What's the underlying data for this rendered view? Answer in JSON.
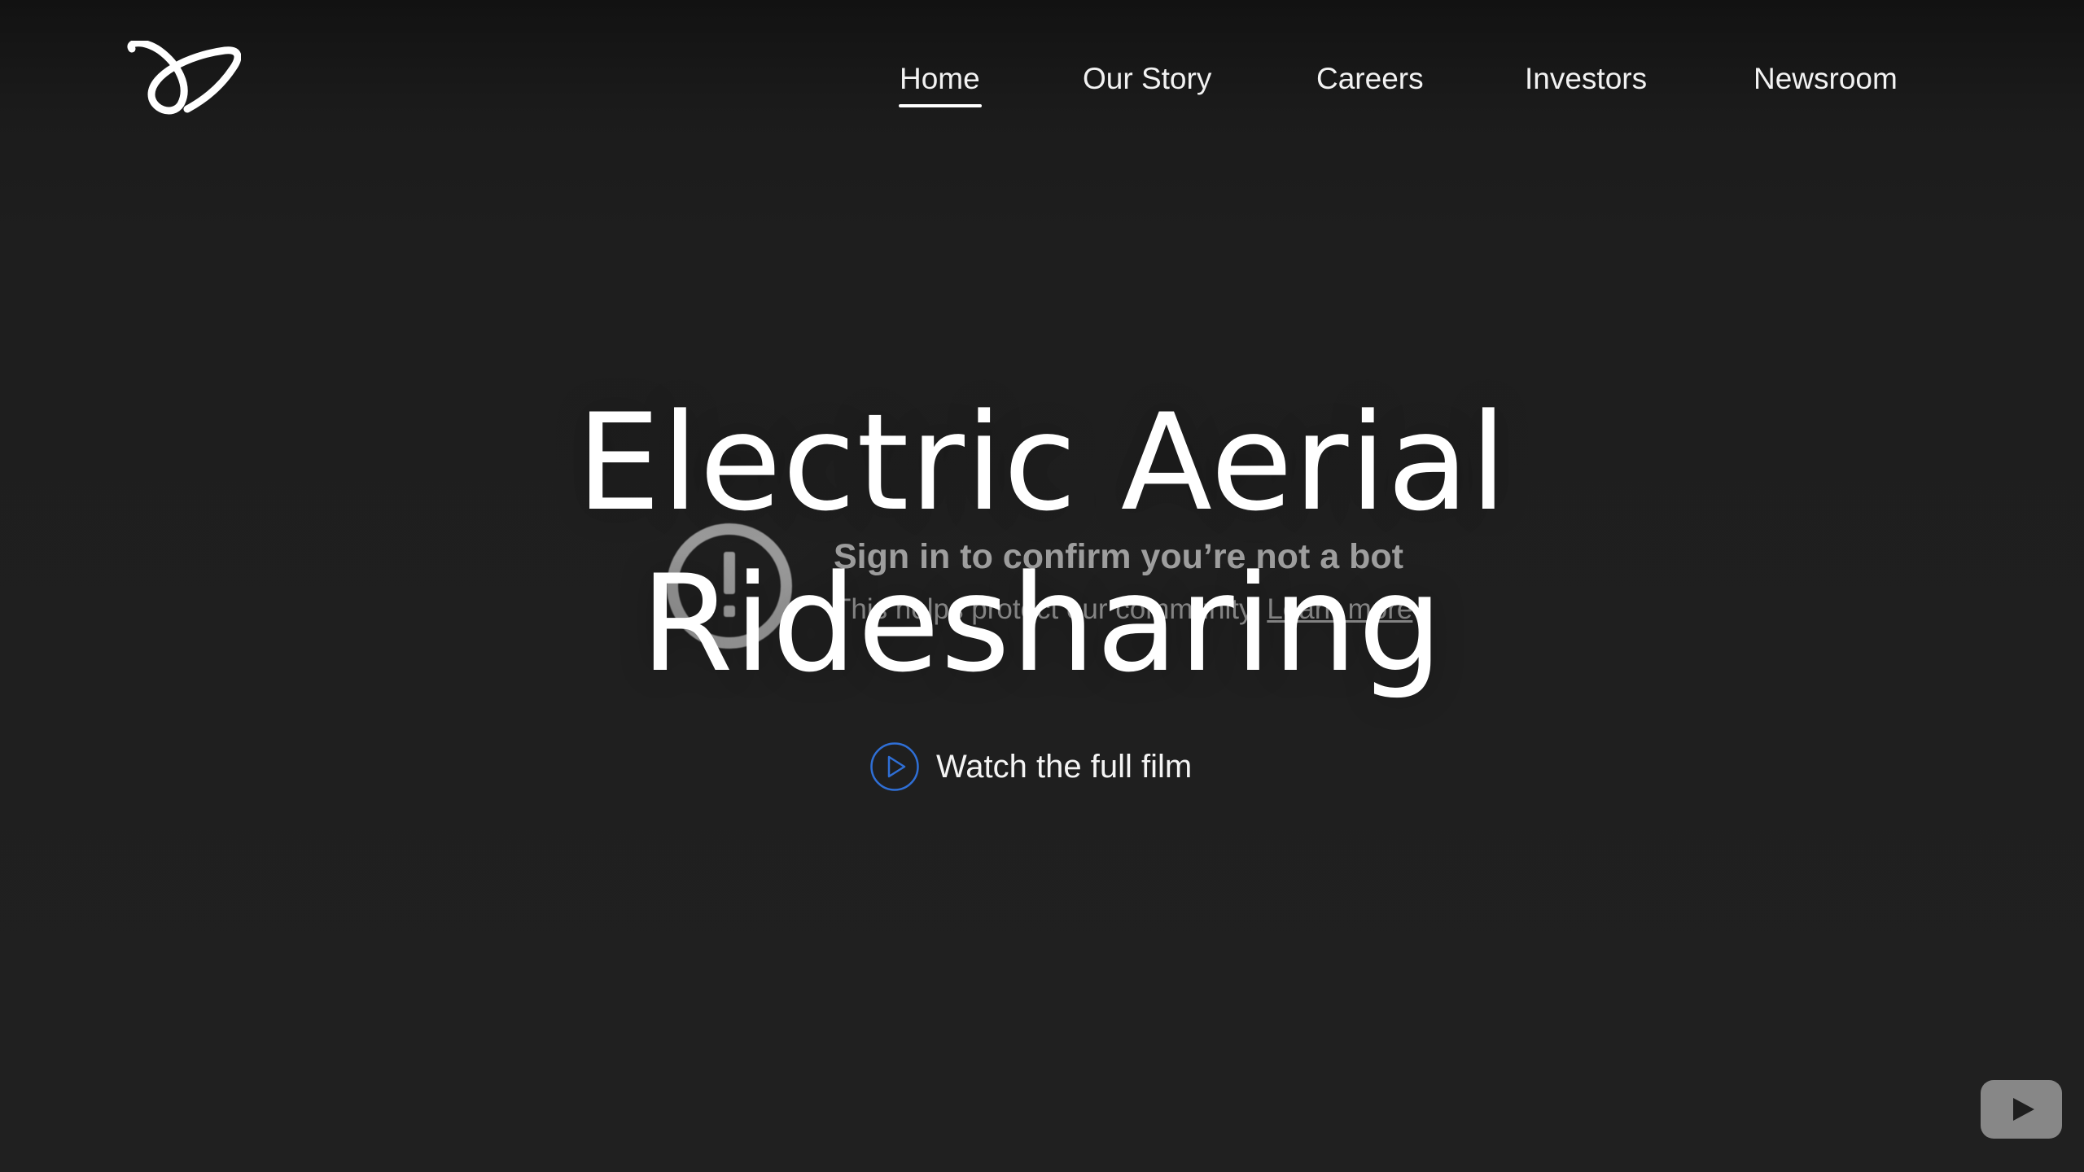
{
  "nav": {
    "items": [
      {
        "label": "Home",
        "active": true
      },
      {
        "label": "Our Story",
        "active": false
      },
      {
        "label": "Careers",
        "active": false
      },
      {
        "label": "Investors",
        "active": false
      },
      {
        "label": "Newsroom",
        "active": false
      }
    ]
  },
  "hero": {
    "title_line1": "Electric Aerial",
    "title_line2": "Ridesharing",
    "cta_label": "Watch the full film"
  },
  "video_overlay": {
    "title": "Sign in to confirm you’re not a bot",
    "subtitle": "This helps protect our community.",
    "link_label": "Learn more"
  },
  "icons": {
    "logo": "brand-logo-icon",
    "alert": "alert-circle-icon",
    "play": "play-circle-icon",
    "youtube": "youtube-play-icon"
  },
  "colors": {
    "background": "#1f1f1f",
    "text": "#ffffff",
    "accent_blue": "#2f6fd6",
    "overlay_text": "#cfcfcf"
  }
}
